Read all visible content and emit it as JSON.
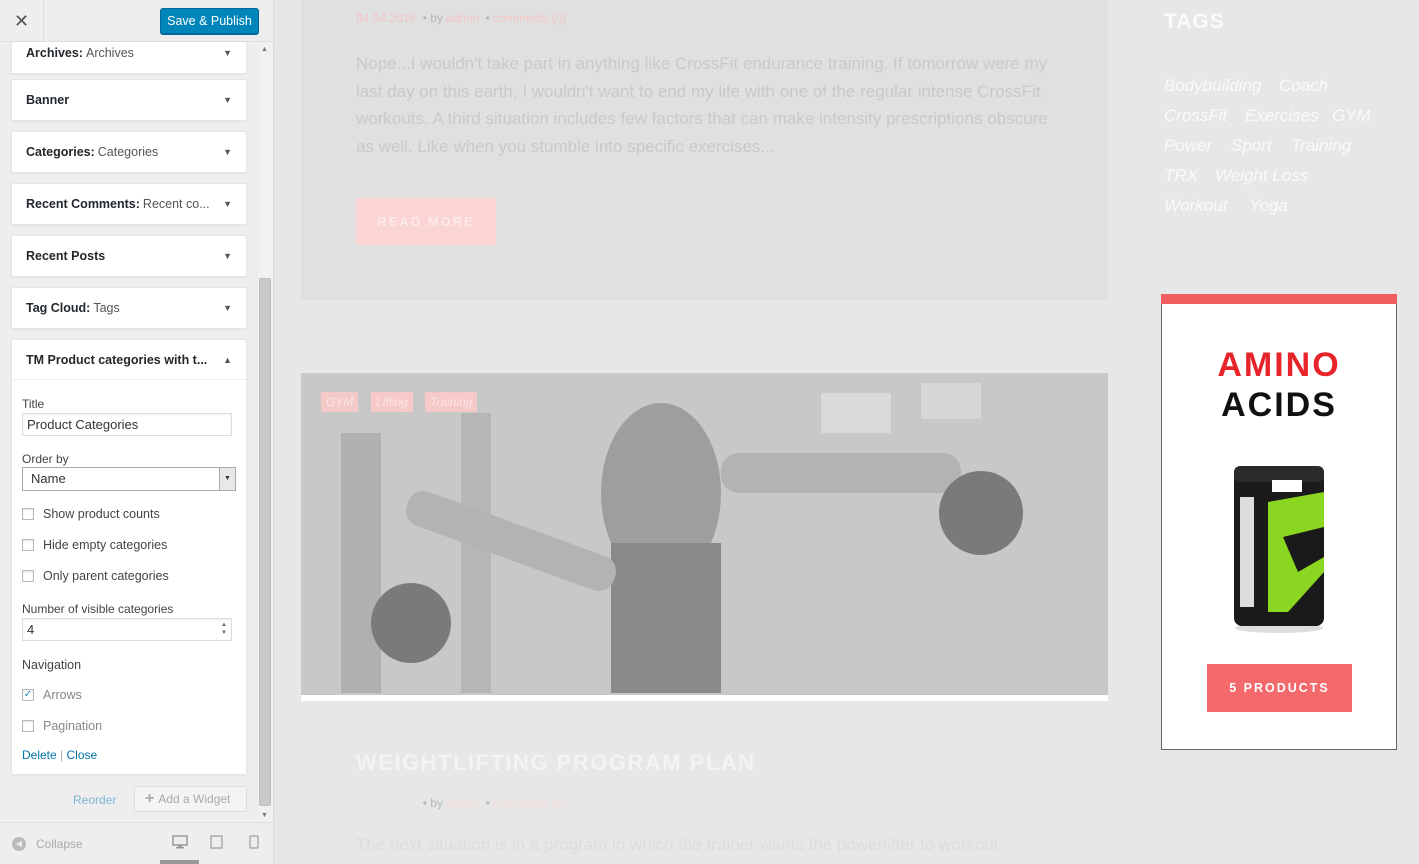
{
  "header": {
    "close_label": "✕",
    "save_label": "Save & Publish"
  },
  "widgets": {
    "archives": {
      "name": "Archives:",
      "sub": "Archives"
    },
    "banner": {
      "name": "Banner",
      "sub": ""
    },
    "categories": {
      "name": "Categories:",
      "sub": "Categories"
    },
    "recent_comments": {
      "name": "Recent Comments:",
      "sub": "Recent co..."
    },
    "recent_posts": {
      "name": "Recent Posts",
      "sub": ""
    },
    "tag_cloud": {
      "name": "Tag Cloud:",
      "sub": "Tags"
    },
    "tm_product": {
      "name": "TM Product categories with t...",
      "sub": ""
    }
  },
  "form": {
    "title_label": "Title",
    "title_value": "Product Categories",
    "order_label": "Order by",
    "order_value": "Name",
    "show_counts": "Show product counts",
    "hide_empty": "Hide empty categories",
    "only_parent": "Only parent categories",
    "visible_label": "Number of visible categories",
    "visible_value": "4",
    "nav_label": "Navigation",
    "arrows": "Arrows",
    "pagination": "Pagination",
    "delete": "Delete",
    "separator": "|",
    "close": "Close"
  },
  "actions": {
    "reorder": "Reorder",
    "add_widget": "Add a Widget"
  },
  "footer": {
    "collapse": "Collapse"
  },
  "preview": {
    "post1": {
      "date": "04.04.2016",
      "by": "by",
      "author": "admin",
      "comments": "comments (0)",
      "excerpt": "Nope...I wouldn't take part in anything like CrossFit endurance training. If tomorrow were my last day on this earth, I wouldn't want to end my life with one of the regular intense CrossFit workouts. A third situation includes few factors that can make intensity prescriptions obscure as well. Like when you stumble into specific exercises...",
      "read_more": "READ MORE"
    },
    "post2": {
      "tags": [
        "GYM",
        "Lifting",
        "Training"
      ],
      "title": "WEIGHTLIFTING PROGRAM PLAN",
      "date": "04.04.2016",
      "by": "by",
      "author": "admin",
      "comments": "comments (0)",
      "excerpt": "The next situation is in a program in which the trainer wants the powerlifter to workout"
    },
    "tags_title": "TAGS",
    "tags": [
      "Bodybuilding",
      "Coach",
      "CrossFit",
      "Exercises",
      "GYM",
      "Power",
      "Sport",
      "Training",
      "TRX",
      "Weight Loss",
      "Workout",
      "Yoga"
    ],
    "banner": {
      "line1": "AMINO",
      "line2": "ACIDS",
      "button": "5 PRODUCTS"
    }
  },
  "colors": {
    "accent": "#0085ba",
    "brand_pink": "#f4696b",
    "amino_red": "#e8242b"
  }
}
